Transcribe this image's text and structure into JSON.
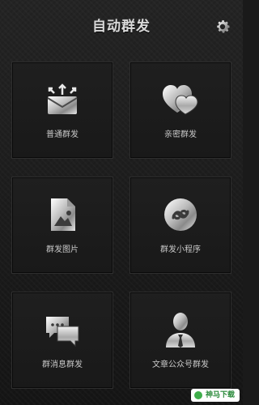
{
  "header": {
    "title": "自动群发",
    "settings_icon": "gear-icon"
  },
  "tiles": [
    {
      "label": "普通群发",
      "icon": "envelope-arrows-icon"
    },
    {
      "label": "亲密群发",
      "icon": "hearts-icon"
    },
    {
      "label": "群发图片",
      "icon": "image-file-icon"
    },
    {
      "label": "群发小程序",
      "icon": "mini-program-icon"
    },
    {
      "label": "群消息群发",
      "icon": "chat-bubbles-icon"
    },
    {
      "label": "文章公众号群发",
      "icon": "person-bowtie-icon"
    }
  ],
  "watermark": {
    "text": "神马下载"
  },
  "colors": {
    "background": "#1a1a1a",
    "tile": "#1c1c1c",
    "text": "#c9c9c9",
    "metal": "#cfcfcf"
  }
}
